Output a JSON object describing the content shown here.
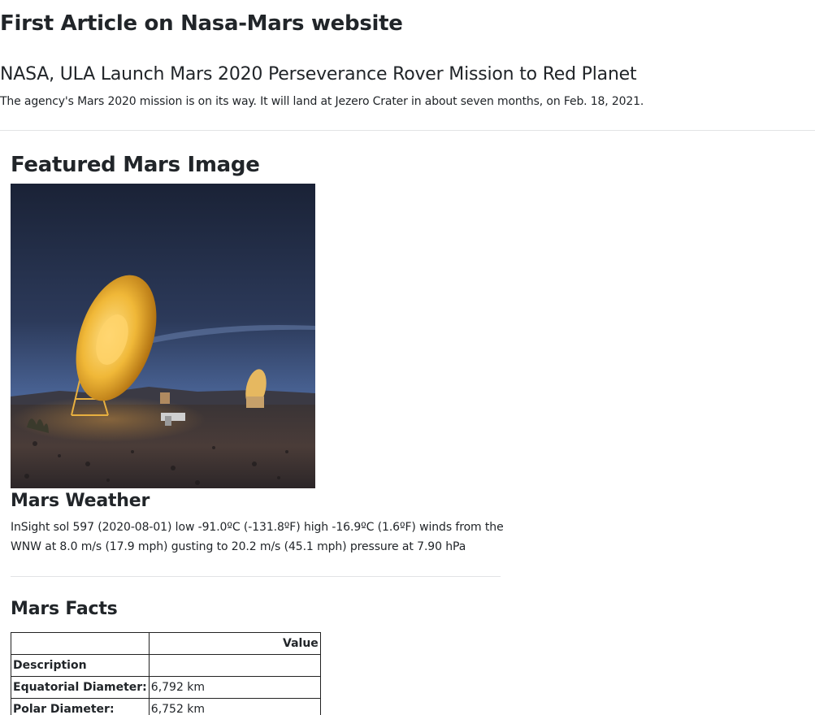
{
  "page": {
    "title": "First Article on Nasa-Mars website"
  },
  "article": {
    "title": "NASA, ULA Launch Mars 2020 Perseverance Rover Mission to Red Planet",
    "teaser": "The agency's Mars 2020 mission is on its way. It will land at Jezero Crater in about seven months, on Feb. 18, 2021."
  },
  "featured_image": {
    "heading": "Featured Mars Image"
  },
  "weather": {
    "heading": "Mars Weather",
    "text": "InSight sol 597 (2020-08-01) low -91.0ºC (-131.8ºF) high -16.9ºC (1.6ºF) winds from the WNW at 8.0 m/s (17.9 mph) gusting to 20.2 m/s (45.1 mph) pressure at 7.90 hPa"
  },
  "facts": {
    "heading": "Mars Facts",
    "header_blank": "",
    "header_value": "Value",
    "rows": [
      {
        "label": "Description",
        "value": ""
      },
      {
        "label": "Equatorial Diameter:",
        "value": "6,792 km"
      },
      {
        "label": "Polar Diameter:",
        "value": "6,752 km"
      }
    ]
  }
}
